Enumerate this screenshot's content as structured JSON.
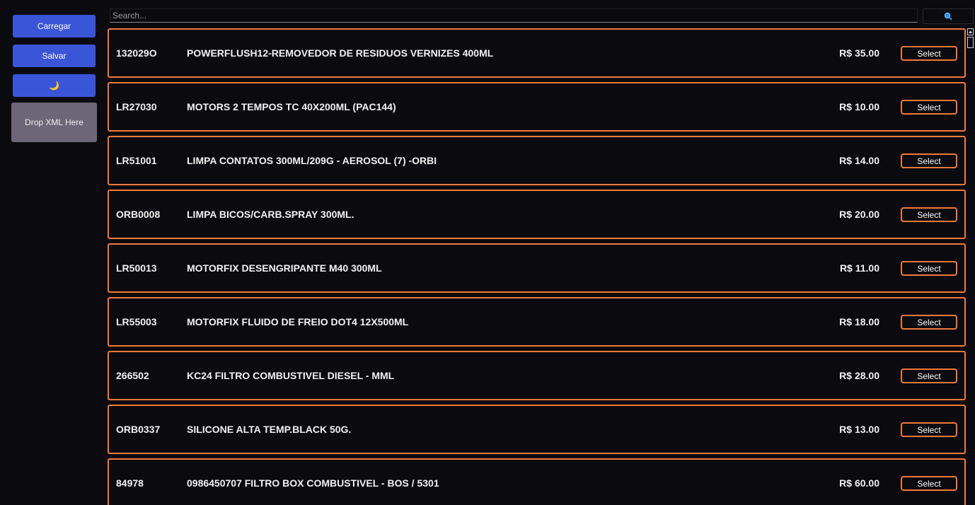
{
  "sidebar": {
    "load_label": "Carregar",
    "save_label": "Salvar",
    "theme_icon": "🌙",
    "drop_label": "Drop XML Here"
  },
  "search": {
    "placeholder": "Search...",
    "value": "",
    "button_icon": "search-icon"
  },
  "colors": {
    "accent": "#f07a3a",
    "primary_button": "#3b55d9",
    "dropzone": "#6c6678",
    "background": "#0b0a0f"
  },
  "products": [
    {
      "code": "132029O",
      "description": "POWERFLUSH12-REMOVEDOR DE RESIDUOS VERNIZES 400ML",
      "price": "R$ 35.00",
      "action": "Select"
    },
    {
      "code": "LR27030",
      "description": "MOTORS 2 TEMPOS TC 40X200ML (PAC144)",
      "price": "R$ 10.00",
      "action": "Select"
    },
    {
      "code": "LR51001",
      "description": "LIMPA CONTATOS 300ML/209G - AEROSOL (7) -ORBI",
      "price": "R$ 14.00",
      "action": "Select"
    },
    {
      "code": "ORB0008",
      "description": "LIMPA BICOS/CARB.SPRAY 300ML.",
      "price": "R$ 20.00",
      "action": "Select"
    },
    {
      "code": "LR50013",
      "description": "MOTORFIX DESENGRIPANTE M40 300ML",
      "price": "R$ 11.00",
      "action": "Select"
    },
    {
      "code": "LR55003",
      "description": "MOTORFIX FLUIDO DE FREIO DOT4 12X500ML",
      "price": "R$ 18.00",
      "action": "Select"
    },
    {
      "code": "266502",
      "description": "KC24 FILTRO COMBUSTIVEL DIESEL - MML",
      "price": "R$ 28.00",
      "action": "Select"
    },
    {
      "code": "ORB0337",
      "description": "SILICONE ALTA TEMP.BLACK 50G.",
      "price": "R$ 13.00",
      "action": "Select"
    },
    {
      "code": "84978",
      "description": "0986450707 FILTRO BOX COMBUSTIVEL - BOS / 5301",
      "price": "R$ 60.00",
      "action": "Select"
    }
  ]
}
